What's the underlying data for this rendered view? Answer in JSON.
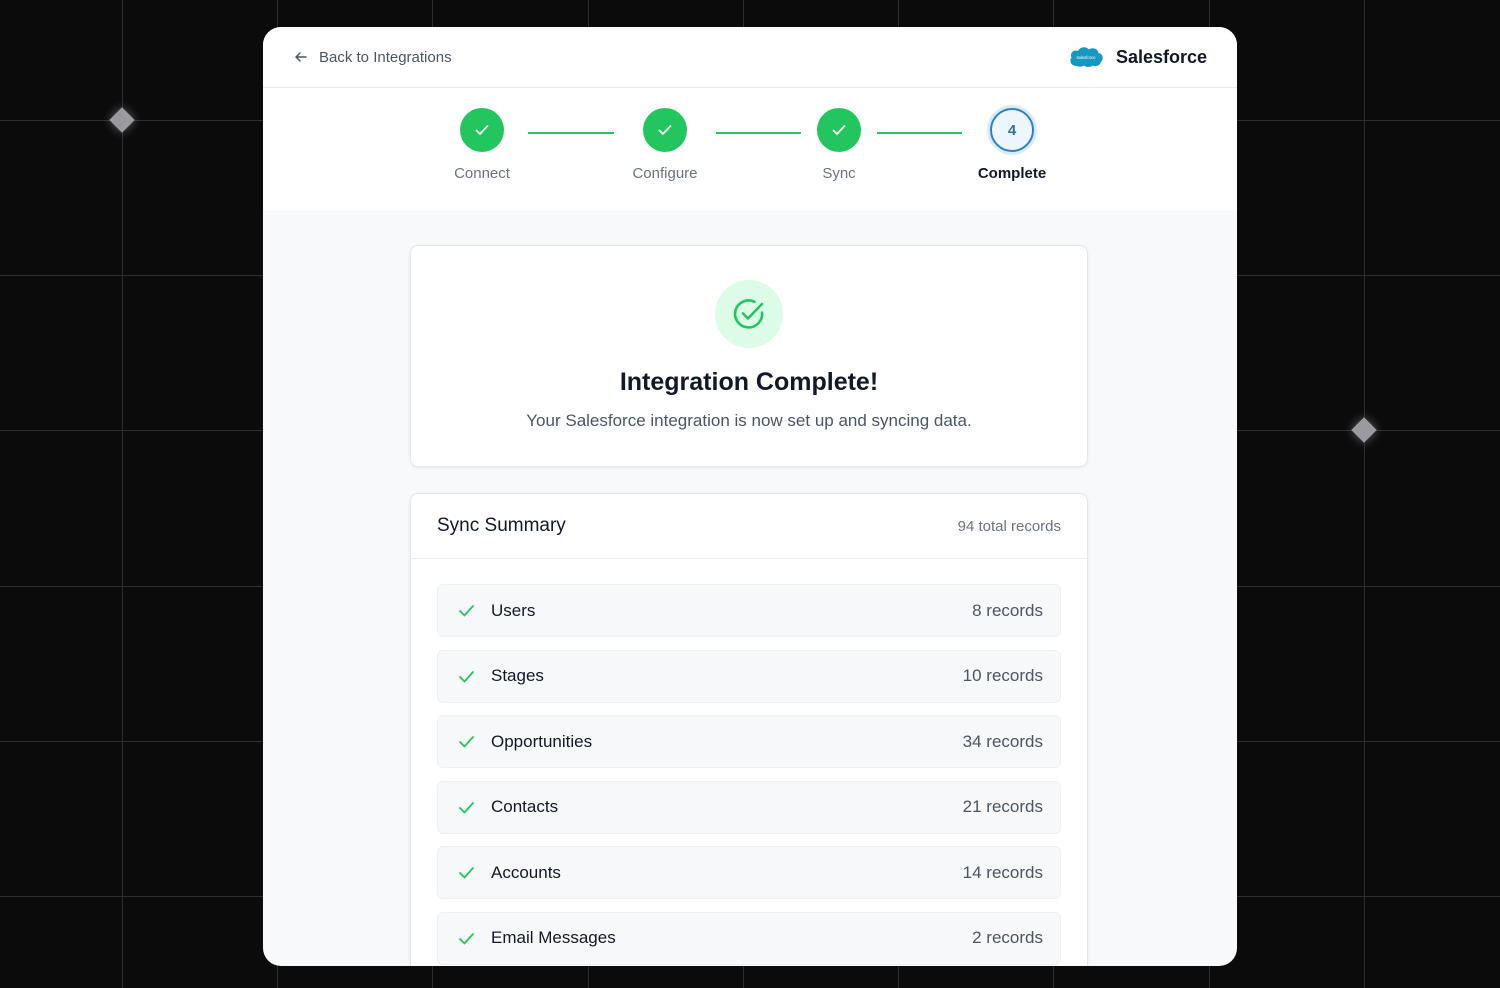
{
  "header": {
    "back_label": "Back to Integrations",
    "brand_name": "Salesforce",
    "logo_text": "salesforce"
  },
  "stepper": {
    "steps": [
      {
        "label": "Connect",
        "status": "done"
      },
      {
        "label": "Configure",
        "status": "done"
      },
      {
        "label": "Sync",
        "status": "done"
      },
      {
        "label": "Complete",
        "status": "current",
        "number": "4"
      }
    ]
  },
  "completion": {
    "title": "Integration Complete!",
    "subtitle": "Your Salesforce integration is now set up and syncing data."
  },
  "summary": {
    "title": "Sync Summary",
    "total": "94 total records",
    "items": [
      {
        "name": "Users",
        "count": "8 records"
      },
      {
        "name": "Stages",
        "count": "10 records"
      },
      {
        "name": "Opportunities",
        "count": "34 records"
      },
      {
        "name": "Contacts",
        "count": "21 records"
      },
      {
        "name": "Accounts",
        "count": "14 records"
      },
      {
        "name": "Email Messages",
        "count": "2 records"
      }
    ]
  },
  "colors": {
    "success": "#22c55e",
    "accent": "#2f80c7",
    "brand": "#1798c1"
  }
}
